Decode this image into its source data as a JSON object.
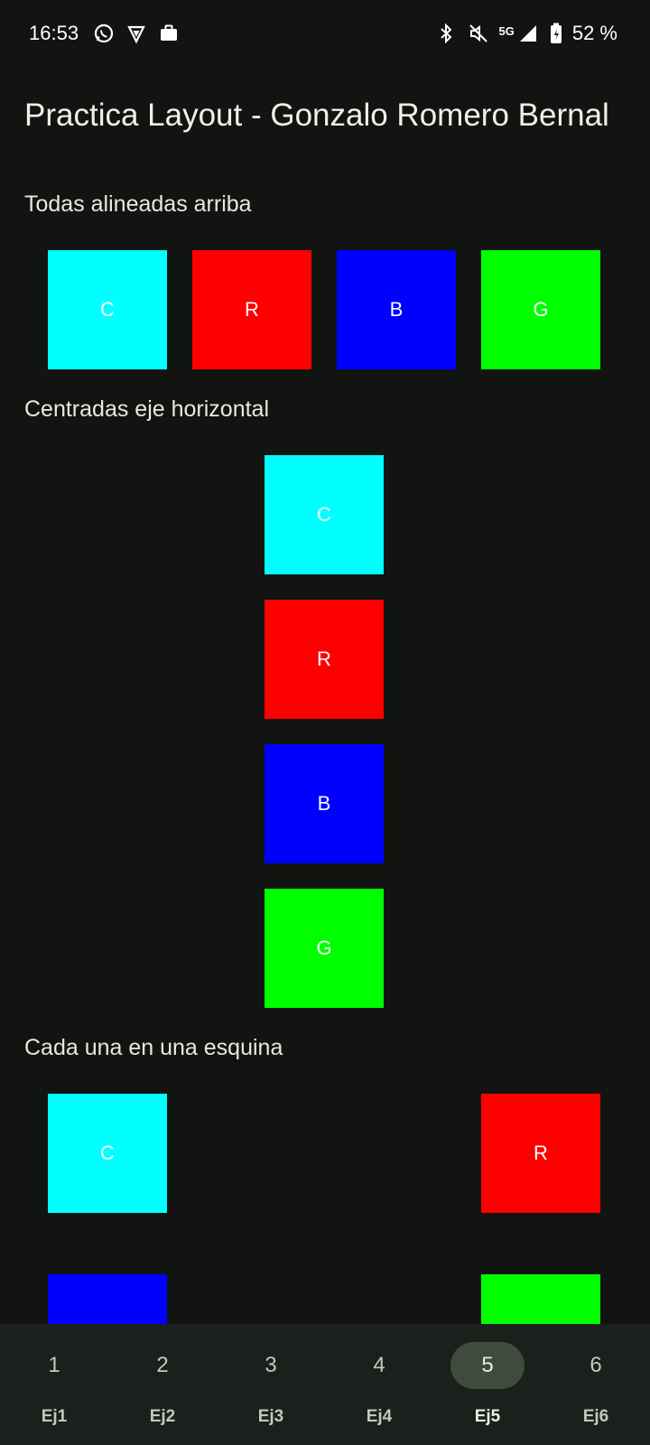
{
  "status_bar": {
    "time": "16:53",
    "left_icons": [
      "whatsapp-icon",
      "vpn-shield-icon",
      "briefcase-icon"
    ],
    "right_icons": [
      "bluetooth-icon",
      "mute-icon",
      "signal-icon",
      "battery-icon"
    ],
    "network": "5G",
    "battery": "52 %"
  },
  "app": {
    "title": "Practica Layout - Gonzalo Romero Bernal"
  },
  "sections": [
    {
      "title": "Todas alineadas arriba",
      "squares": [
        "C",
        "R",
        "B",
        "G"
      ]
    },
    {
      "title": "Centradas eje horizontal",
      "squares": [
        "C",
        "R",
        "B",
        "G"
      ]
    },
    {
      "title": "Cada una en una esquina",
      "squares": [
        "C",
        "R",
        "",
        ""
      ]
    }
  ],
  "colors": {
    "cyan": "#00ffff",
    "red": "#ff0000",
    "blue": "#0000ff",
    "green": "#00ff00",
    "background": "#121411",
    "nav_active": "#3f4b3c"
  },
  "bottom_nav": {
    "items": [
      {
        "icon": "1",
        "label": "Ej1"
      },
      {
        "icon": "2",
        "label": "Ej2"
      },
      {
        "icon": "3",
        "label": "Ej3"
      },
      {
        "icon": "4",
        "label": "Ej4"
      },
      {
        "icon": "5",
        "label": "Ej5"
      },
      {
        "icon": "6",
        "label": "Ej6"
      }
    ],
    "selected": "Ej5"
  }
}
